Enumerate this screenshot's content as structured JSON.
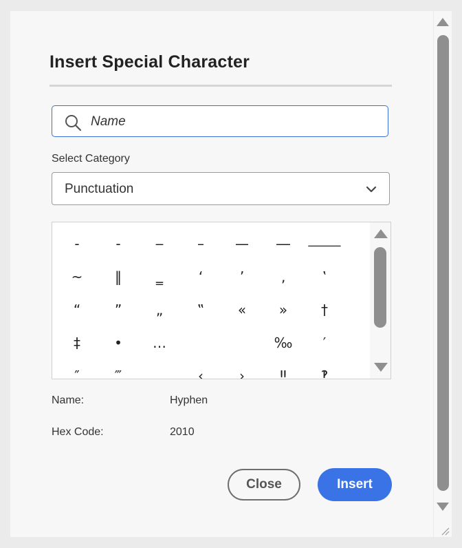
{
  "dialog": {
    "title": "Insert Special Character",
    "search": {
      "placeholder": "Name",
      "value": ""
    },
    "category_label": "Select Category",
    "category_value": "Punctuation",
    "characters": [
      "‐",
      "‑",
      "‒",
      "–",
      "—",
      "―",
      "⸻",
      "~",
      "‖",
      "‗",
      "‘",
      "’",
      "‚",
      "‛",
      "“",
      "”",
      "„",
      "‟",
      "«",
      "»",
      "†",
      "‡",
      "•",
      "…",
      "",
      "",
      "‰",
      "′",
      "″",
      "‴",
      "",
      "‹",
      "›",
      "‼",
      "‽"
    ],
    "selected": {
      "name_label": "Name:",
      "name_value": "Hyphen",
      "hex_label": "Hex Code:",
      "hex_value": "2010"
    },
    "buttons": {
      "close": "Close",
      "insert": "Insert"
    }
  },
  "icons": {
    "search": "search-icon",
    "dropdown": "chevron-down-icon"
  },
  "colors": {
    "accent": "#3a73e6",
    "focus_border": "#3a6fd8"
  }
}
